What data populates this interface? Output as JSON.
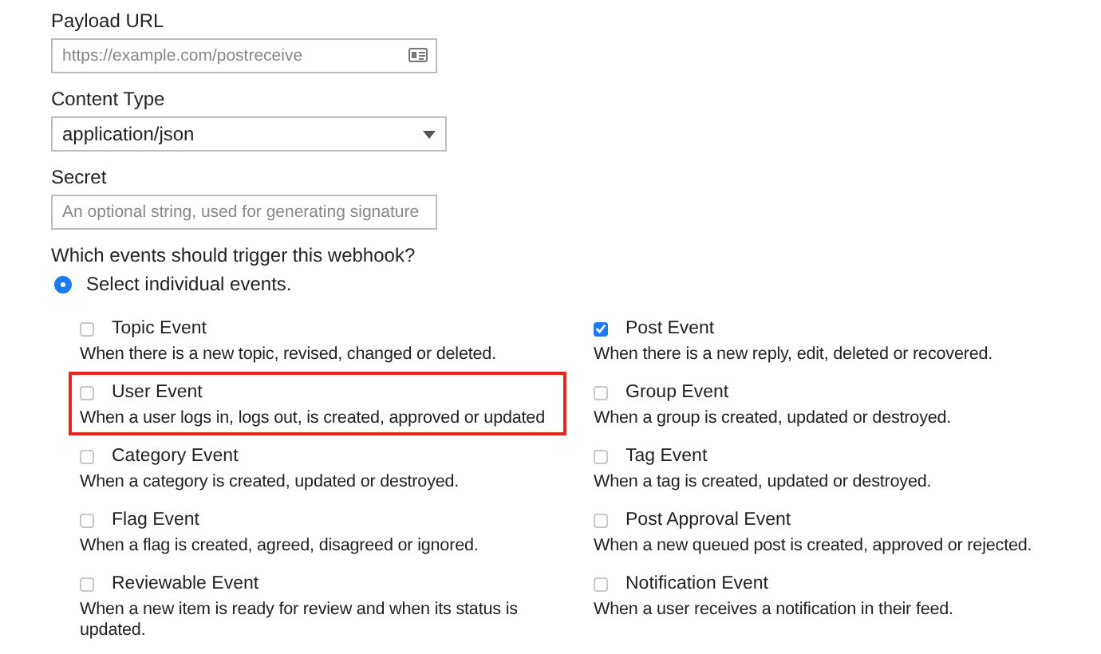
{
  "fields": [
    {
      "kind": "text",
      "label": "Payload URL",
      "placeholder": "https://example.com/postreceive"
    },
    {
      "kind": "select",
      "label": "Content Type",
      "value": "application/json"
    },
    {
      "kind": "text-plain",
      "label": "Secret",
      "placeholder": "An optional string, used for generating signature"
    }
  ],
  "trigger": {
    "question": "Which events should trigger this webhook?",
    "options": [
      {
        "label": "Select individual events.",
        "selected": true
      }
    ]
  },
  "events": [
    {
      "name": "Topic Event",
      "description": "When there is a new topic, revised, changed or deleted.",
      "checked": false,
      "highlighted": false
    },
    {
      "name": "Post Event",
      "description": "When there is a new reply, edit, deleted or recovered.",
      "checked": true,
      "highlighted": false
    },
    {
      "name": "User Event",
      "description": "When a user logs in, logs out, is created, approved or updated",
      "checked": false,
      "highlighted": true
    },
    {
      "name": "Group Event",
      "description": "When a group is created, updated or destroyed.",
      "checked": false,
      "highlighted": false
    },
    {
      "name": "Category Event",
      "description": "When a category is created, updated or destroyed.",
      "checked": false,
      "highlighted": false
    },
    {
      "name": "Tag Event",
      "description": "When a tag is created, updated or destroyed.",
      "checked": false,
      "highlighted": false
    },
    {
      "name": "Flag Event",
      "description": "When a flag is created, agreed, disagreed or ignored.",
      "checked": false,
      "highlighted": false
    },
    {
      "name": "Post Approval Event",
      "description": "When a new queued post is created, approved or rejected.",
      "checked": false,
      "highlighted": false
    },
    {
      "name": "Reviewable Event",
      "description": "When a new item is ready for review and when its status is updated.",
      "checked": false,
      "highlighted": false
    },
    {
      "name": "Notification Event",
      "description": "When a user receives a notification in their feed.",
      "checked": false,
      "highlighted": false
    }
  ]
}
